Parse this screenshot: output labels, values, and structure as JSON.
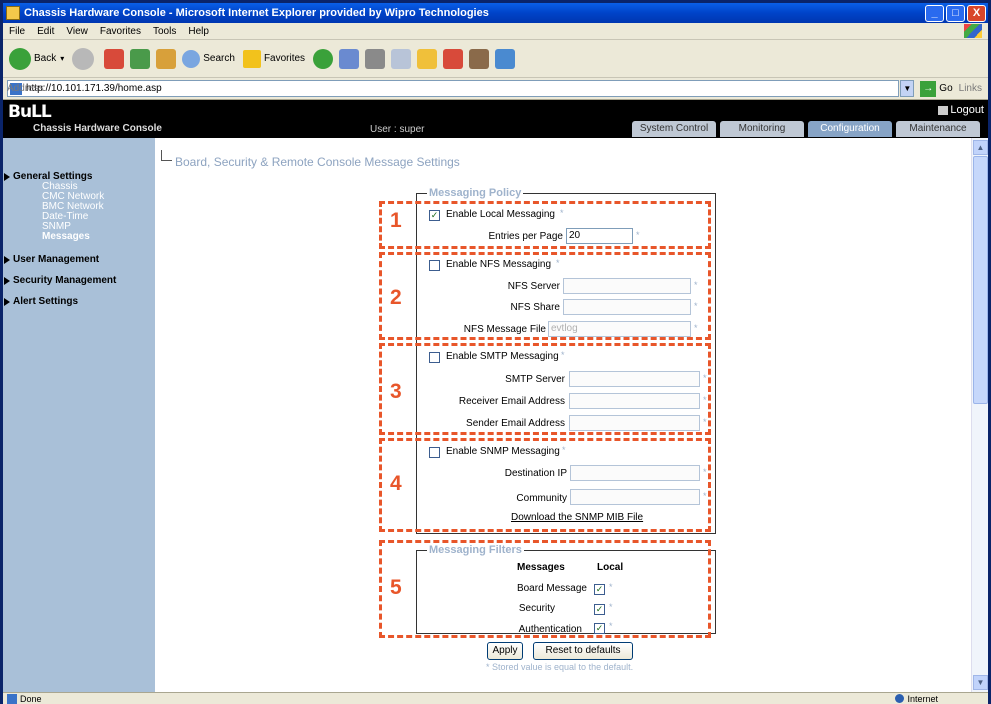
{
  "window": {
    "title": "Chassis Hardware Console - Microsoft Internet Explorer provided by Wipro Technologies",
    "minimize": "_",
    "maximize": "□",
    "close": "X"
  },
  "menu": [
    "File",
    "Edit",
    "View",
    "Favorites",
    "Tools",
    "Help"
  ],
  "toolbar": {
    "back": "Back",
    "search": "Search",
    "favorites": "Favorites"
  },
  "address": {
    "label": "Address",
    "url": "http://10.101.171.39/home.asp",
    "go": "Go",
    "links": "Links"
  },
  "app": {
    "logo": "BuLL",
    "logout": "Logout",
    "name": "Chassis Hardware Console",
    "user": "User : super",
    "tabs": [
      "System Control",
      "Monitoring",
      "Configuration",
      "Maintenance"
    ],
    "active_tab": "Configuration"
  },
  "sidebar": {
    "groups": [
      {
        "label": "General Settings",
        "items": [
          "Chassis",
          "CMC Network",
          "BMC Network",
          "Date-Time",
          "SNMP",
          "Messages"
        ]
      },
      {
        "label": "User Management",
        "items": []
      },
      {
        "label": "Security Management",
        "items": []
      },
      {
        "label": "Alert Settings",
        "items": []
      }
    ],
    "active_item": "Messages"
  },
  "page": {
    "title": "Board, Security & Remote Console Message Settings"
  },
  "messaging_policy": {
    "legend": "Messaging Policy",
    "local": {
      "label": "Enable Local Messaging",
      "checked": true,
      "entries_label": "Entries per Page",
      "entries_value": "20"
    },
    "nfs": {
      "label": "Enable NFS Messaging",
      "checked": false,
      "server_label": "NFS Server",
      "share_label": "NFS Share",
      "file_label": "NFS Message File",
      "file_value": "evtlog"
    },
    "smtp": {
      "label": "Enable SMTP Messaging",
      "checked": false,
      "server_label": "SMTP Server",
      "receiver_label": "Receiver Email Address",
      "sender_label": "Sender Email Address"
    },
    "snmp": {
      "label": "Enable SNMP Messaging",
      "checked": false,
      "dest_label": "Destination IP",
      "community_label": "Community",
      "mib_link": "Download the SNMP MIB File"
    }
  },
  "messaging_filters": {
    "legend": "Messaging Filters",
    "col_messages": "Messages",
    "col_local": "Local",
    "rows": [
      {
        "label": "Board Message",
        "checked": true
      },
      {
        "label": "Security",
        "checked": true
      },
      {
        "label": "Authentication",
        "checked": true
      }
    ]
  },
  "highlights": [
    "1",
    "2",
    "3",
    "4",
    "5"
  ],
  "required_mark": "*",
  "checkmark": "✓",
  "buttons": {
    "apply": "Apply",
    "reset": "Reset to defaults"
  },
  "note": "* Stored value is equal to the default.",
  "status": {
    "text": "Done",
    "zone": "Internet"
  },
  "colors": {
    "highlight": "#e8562a",
    "sidebar": "#a9c0d8",
    "title": "#8da3c0"
  }
}
